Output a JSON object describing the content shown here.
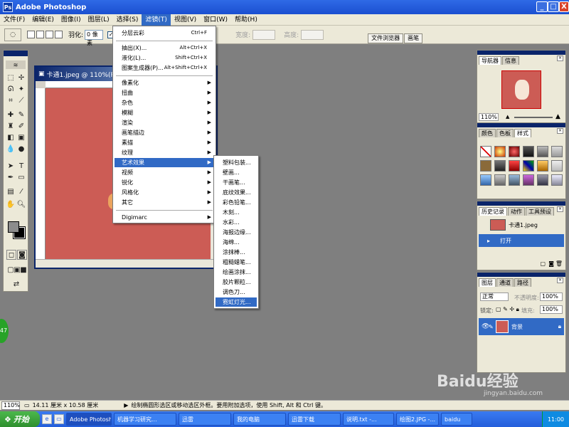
{
  "window": {
    "title": "Adobe Photoshop",
    "logo": "Ps",
    "min_btn": "_",
    "max_btn": "□",
    "close_btn": "X"
  },
  "menubar": {
    "items": [
      {
        "label": "文件(F)"
      },
      {
        "label": "编辑(E)"
      },
      {
        "label": "图像(I)"
      },
      {
        "label": "图层(L)"
      },
      {
        "label": "选择(S)"
      },
      {
        "label": "滤镜(T)"
      },
      {
        "label": "视图(V)"
      },
      {
        "label": "窗口(W)"
      },
      {
        "label": "帮助(H)"
      }
    ]
  },
  "options": {
    "feather_label": "羽化:",
    "feather_value": "0 像素",
    "antialias_label": "消",
    "width_label": "宽度:",
    "height_label": "高度:",
    "tabs": [
      "文件浏览器",
      "画笔"
    ]
  },
  "document": {
    "title": "卡通1.jpeg @ 110%(RGB)"
  },
  "filter_menu": {
    "items": [
      {
        "label": "分层云彩",
        "shortcut": "Ctrl+F"
      },
      {
        "label": "抽出(X)...",
        "shortcut": "Alt+Ctrl+X"
      },
      {
        "label": "液化(L)...",
        "shortcut": "Shift+Ctrl+X"
      },
      {
        "label": "图案生成器(P)...",
        "shortcut": "Alt+Shift+Ctrl+X"
      },
      {
        "label": "像素化"
      },
      {
        "label": "扭曲"
      },
      {
        "label": "杂色"
      },
      {
        "label": "模糊"
      },
      {
        "label": "渲染"
      },
      {
        "label": "画笔描边"
      },
      {
        "label": "素描"
      },
      {
        "label": "纹理"
      },
      {
        "label": "艺术效果"
      },
      {
        "label": "视频"
      },
      {
        "label": "锐化"
      },
      {
        "label": "风格化"
      },
      {
        "label": "其它"
      },
      {
        "label": "Digimarc"
      }
    ]
  },
  "artistic_submenu": {
    "items": [
      "塑料包装...",
      "壁画...",
      "干画笔...",
      "底纹效果...",
      "彩色铅笔...",
      "木刻...",
      "水彩...",
      "海报边缘...",
      "海绵...",
      "涂抹棒...",
      "粗糙蜡笔...",
      "绘画涂抹...",
      "胶片颗粒...",
      "调色刀...",
      "霓虹灯光..."
    ]
  },
  "navigator": {
    "tabs": [
      "导航器",
      "信息"
    ],
    "zoom": "110%"
  },
  "swatches": {
    "tabs": [
      "颜色",
      "色板",
      "样式"
    ]
  },
  "history": {
    "tabs": [
      "历史记录",
      "动作",
      "工具预设"
    ],
    "snapshot": "卡通1.jpeg",
    "step": "打开"
  },
  "layers": {
    "tabs": [
      "图层",
      "通道",
      "路径"
    ],
    "blend_mode": "正常",
    "opacity_label": "不透明度:",
    "opacity": "100%",
    "lock_label": "锁定:",
    "fill_label": "填充:",
    "fill": "100%",
    "layer_name": "背景"
  },
  "status": {
    "zoom": "110%",
    "size": "14.11 厘米 x 10.58 厘米",
    "hint": "绘制椭圆形选区或移动选区外框。要用附加选项，使用 Shift, Alt 和 Ctrl 键。"
  },
  "taskbar": {
    "start": "开始",
    "items": [
      "Adobe Photoshop",
      "机器学习研究...",
      "迅雷",
      "我的电脑",
      "迅雷下载",
      "说明.txt -...",
      "绘图2.JPG -...",
      "baidu"
    ],
    "clock": "11:00"
  },
  "watermark": {
    "text": "Baidu经验",
    "url": "jingyan.baidu.com"
  },
  "badge": {
    "text": "47"
  }
}
